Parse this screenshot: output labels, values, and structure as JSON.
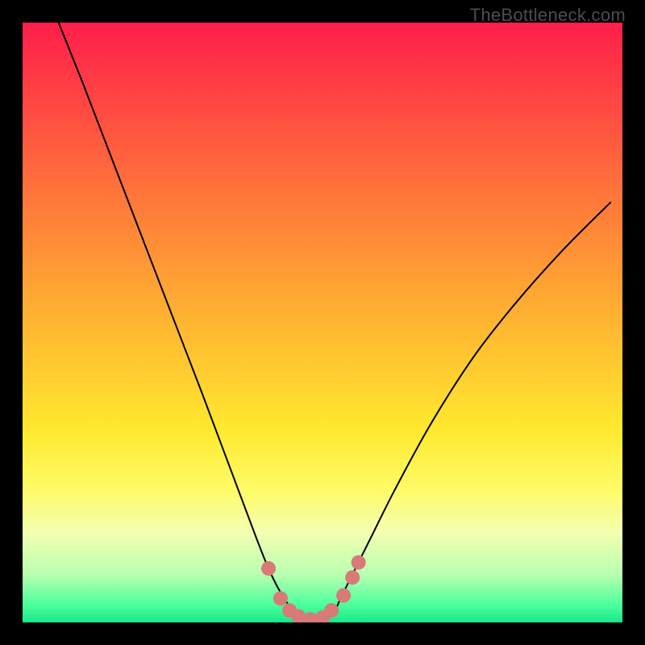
{
  "watermark": "TheBottleneck.com",
  "chart_data": {
    "type": "line",
    "title": "",
    "xlabel": "",
    "ylabel": "",
    "xlim": [
      0,
      100
    ],
    "ylim": [
      0,
      100
    ],
    "background_gradient_stops": [
      {
        "offset": 0,
        "color": "#ff1e4b"
      },
      {
        "offset": 25,
        "color": "#ff6a3c"
      },
      {
        "offset": 50,
        "color": "#ffb531"
      },
      {
        "offset": 68,
        "color": "#ffe92f"
      },
      {
        "offset": 78,
        "color": "#fffb68"
      },
      {
        "offset": 85,
        "color": "#f4ffb1"
      },
      {
        "offset": 92,
        "color": "#b8ffb0"
      },
      {
        "offset": 97,
        "color": "#4dff9d"
      },
      {
        "offset": 100,
        "color": "#19e888"
      }
    ],
    "series": [
      {
        "name": "bottleneck-curve",
        "color": "#000000",
        "stroke_width": 2,
        "x": [
          6,
          10,
          15,
          20,
          25,
          30,
          33,
          36,
          39,
          41,
          43,
          45,
          46,
          47,
          48,
          50,
          52,
          53,
          55,
          58,
          62,
          68,
          75,
          82,
          90,
          98
        ],
        "y": [
          100,
          90,
          77,
          64,
          51,
          38,
          30,
          22,
          14,
          9,
          5,
          2,
          1,
          0.5,
          0.5,
          1,
          2,
          4,
          8,
          14,
          22,
          33,
          44,
          53,
          62,
          70
        ]
      }
    ],
    "markers": {
      "name": "highlight-dots",
      "color": "#d87a77",
      "radius": 9,
      "points": [
        {
          "x": 41,
          "y": 9
        },
        {
          "x": 43,
          "y": 4
        },
        {
          "x": 44.5,
          "y": 2
        },
        {
          "x": 46,
          "y": 1
        },
        {
          "x": 48,
          "y": 0.5
        },
        {
          "x": 50,
          "y": 0.8
        },
        {
          "x": 51.5,
          "y": 2
        },
        {
          "x": 53.5,
          "y": 4.5
        },
        {
          "x": 55,
          "y": 7.5
        },
        {
          "x": 56,
          "y": 10
        }
      ]
    }
  }
}
